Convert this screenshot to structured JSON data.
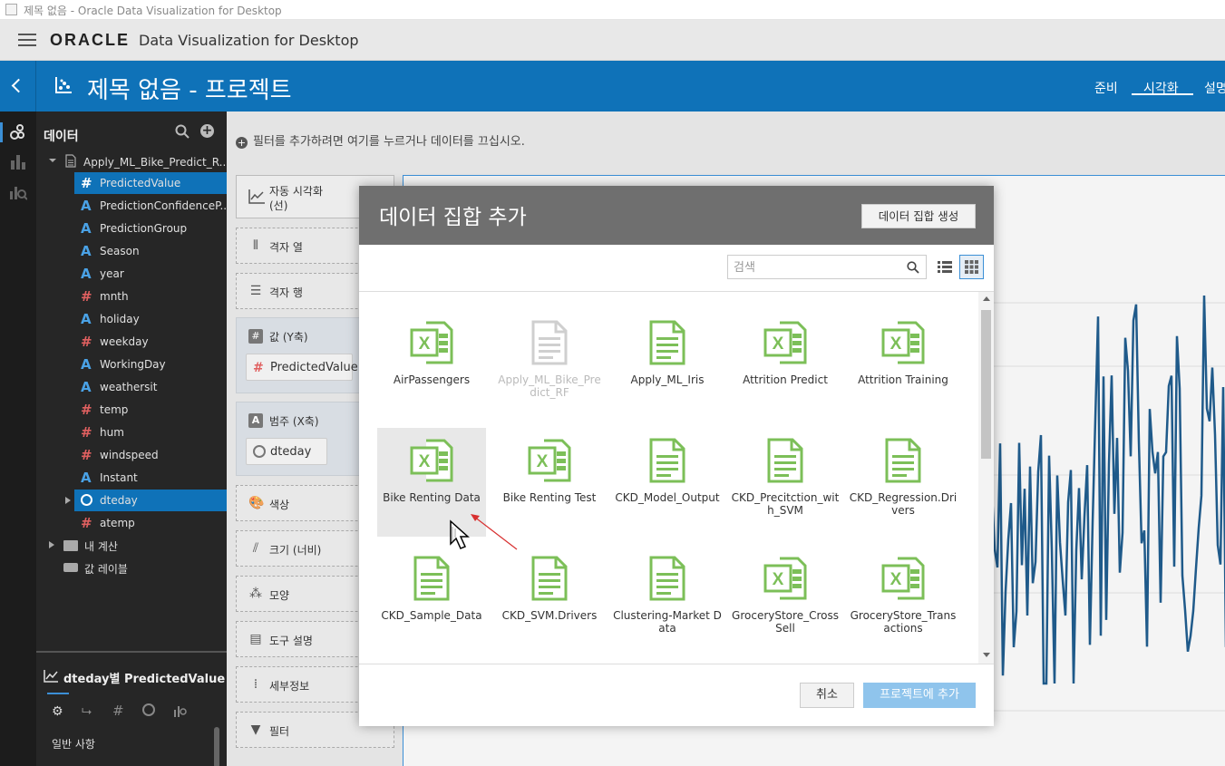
{
  "window": {
    "title": "제목 없음 - Oracle Data Visualization for Desktop"
  },
  "app": {
    "logo": "ORACLE",
    "title": "Data Visualization for Desktop"
  },
  "project": {
    "title": "제목 없음 - 프로젝트",
    "nav": [
      {
        "label": "준비",
        "active": false
      },
      {
        "label": "시각화",
        "active": true
      },
      {
        "label": "설명",
        "active": false
      }
    ]
  },
  "rail": {
    "icons": [
      "data-icon",
      "visualizations-icon",
      "analytics-icon"
    ]
  },
  "data_panel": {
    "title": "데이터",
    "dataset": "Apply_ML_Bike_Predict_R...",
    "columns": [
      {
        "name": "PredictedValue",
        "type": "#",
        "selected": true
      },
      {
        "name": "PredictionConfidenceP...",
        "type": "A",
        "selected": false
      },
      {
        "name": "PredictionGroup",
        "type": "A",
        "selected": false
      },
      {
        "name": "Season",
        "type": "A",
        "selected": false
      },
      {
        "name": "year",
        "type": "A",
        "selected": false
      },
      {
        "name": "mnth",
        "type": "#",
        "selected": false
      },
      {
        "name": "holiday",
        "type": "A",
        "selected": false
      },
      {
        "name": "weekday",
        "type": "#",
        "selected": false
      },
      {
        "name": "WorkingDay",
        "type": "A",
        "selected": false
      },
      {
        "name": "weathersit",
        "type": "A",
        "selected": false
      },
      {
        "name": "temp",
        "type": "#",
        "selected": false
      },
      {
        "name": "hum",
        "type": "#",
        "selected": false
      },
      {
        "name": "windspeed",
        "type": "#",
        "selected": false
      },
      {
        "name": "Instant",
        "type": "A",
        "selected": false
      },
      {
        "name": "dteday",
        "type": "clock",
        "selected": true
      },
      {
        "name": "atemp",
        "type": "#",
        "selected": false
      }
    ],
    "my_calcs": "내 계산",
    "value_labels": "값 레이블"
  },
  "viz_properties": {
    "title": "dteday별 PredictedValue",
    "general": "일반 사항"
  },
  "canvas": {
    "filter_hint": "필터를 추가하려면 여기를 누르거나 데이터를 끄십시오.",
    "viz_type": {
      "line1": "자동 시각화",
      "line2": "(선)"
    },
    "grid_cols": "격자 열",
    "grid_rows": "격자 행",
    "values_y": "값 (Y축)",
    "values_y_pill": "PredictedValue",
    "category_x": "범주 (X축)",
    "category_x_pill": "dteday",
    "color": "색상",
    "size": "크기 (너비)",
    "shape": "모양",
    "tooltip": "도구 설명",
    "detail": "세부정보",
    "filter": "필터"
  },
  "modal": {
    "title": "데이터 집합 추가",
    "create_button": "데이터 집합 생성",
    "search_placeholder": "검색",
    "cancel": "취소",
    "add": "프로젝트에 추가",
    "datasets": [
      {
        "name": "AirPassengers",
        "kind": "excel",
        "disabled": false,
        "hover": false
      },
      {
        "name": "Apply_ML_Bike_Predict_RF",
        "kind": "doc",
        "disabled": true,
        "hover": false
      },
      {
        "name": "Apply_ML_Iris",
        "kind": "doc",
        "disabled": false,
        "hover": false
      },
      {
        "name": "Attrition Predict",
        "kind": "excel",
        "disabled": false,
        "hover": false
      },
      {
        "name": "Attrition Training",
        "kind": "excel",
        "disabled": false,
        "hover": false
      },
      {
        "name": "Bike Renting Data",
        "kind": "excel",
        "disabled": false,
        "hover": true
      },
      {
        "name": "Bike Renting Test",
        "kind": "excel",
        "disabled": false,
        "hover": false
      },
      {
        "name": "CKD_Model_Output",
        "kind": "doc",
        "disabled": false,
        "hover": false
      },
      {
        "name": "CKD_Precitction_with_SVM",
        "kind": "doc",
        "disabled": false,
        "hover": false
      },
      {
        "name": "CKD_Regression.Drivers",
        "kind": "doc",
        "disabled": false,
        "hover": false
      },
      {
        "name": "CKD_Sample_Data",
        "kind": "doc",
        "disabled": false,
        "hover": false
      },
      {
        "name": "CKD_SVM.Drivers",
        "kind": "doc",
        "disabled": false,
        "hover": false
      },
      {
        "name": "Clustering-Market Data",
        "kind": "doc",
        "disabled": false,
        "hover": false
      },
      {
        "name": "GroceryStore_CrossSell",
        "kind": "excel",
        "disabled": false,
        "hover": false
      },
      {
        "name": "GroceryStore_Transactions",
        "kind": "excel",
        "disabled": false,
        "hover": false
      }
    ]
  },
  "colors": {
    "accent": "#0f72b8",
    "chart_line": "#1f5a8a",
    "excel_green": "#7cbf58"
  }
}
